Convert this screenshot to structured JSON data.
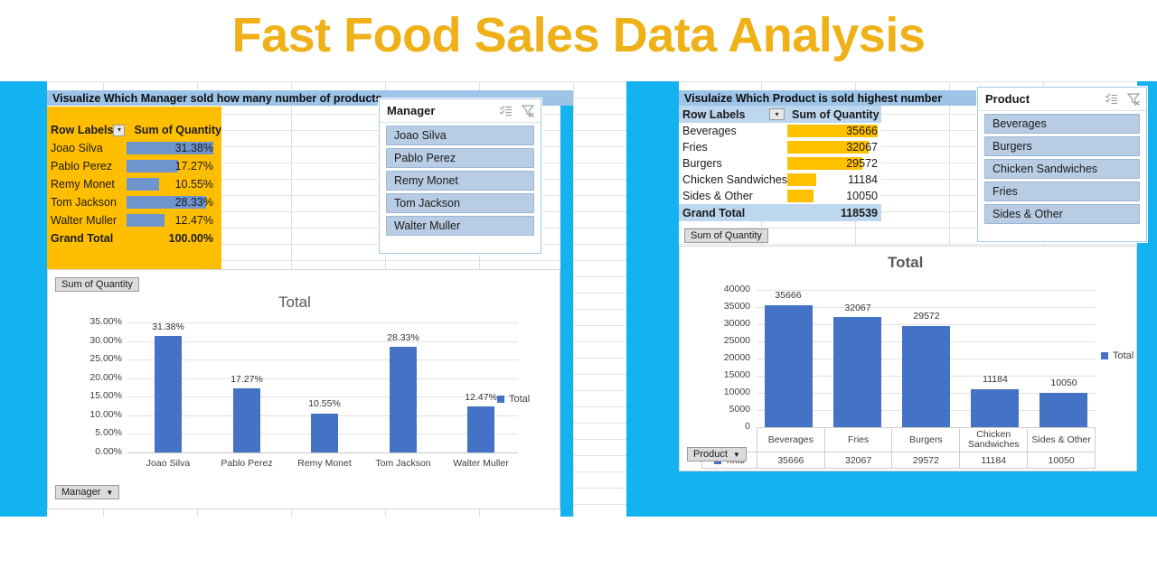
{
  "page": {
    "title": "Fast Food Sales Data Analysis",
    "title_color": "#EFB117",
    "background": "#13B2F0"
  },
  "left_panel": {
    "banner": "Visualize Which Manager sold how many number of products",
    "pivot": {
      "col_headers": [
        "Row Labels",
        "Sum of Quantity"
      ],
      "rows": [
        {
          "label": "Joao Silva",
          "value": "31.38%",
          "pct": 31.38
        },
        {
          "label": "Pablo Perez",
          "value": "17.27%",
          "pct": 17.27
        },
        {
          "label": "Remy Monet",
          "value": "10.55%",
          "pct": 10.55
        },
        {
          "label": "Tom Jackson",
          "value": "28.33%",
          "pct": 28.33
        },
        {
          "label": "Walter Muller",
          "value": "12.47%",
          "pct": 12.47
        }
      ],
      "total_label": "Grand Total",
      "total_value": "100.00%"
    },
    "slicer": {
      "title": "Manager",
      "multiselect_icon": "multi-select-icon",
      "clear_filter_icon": "clear-filter-icon",
      "items": [
        "Joao Silva",
        "Pablo Perez",
        "Remy Monet",
        "Tom Jackson",
        "Walter Muller"
      ]
    },
    "chart_field_button": "Sum of Quantity",
    "chart_axis_button": "Manager"
  },
  "right_panel": {
    "banner": "Visulaize Which Product is sold highest number",
    "pivot": {
      "col_headers": [
        "Row Labels",
        "Sum of Quantity"
      ],
      "rows": [
        {
          "label": "Beverages",
          "value": "35666",
          "num": 35666
        },
        {
          "label": "Fries",
          "value": "32067",
          "num": 32067
        },
        {
          "label": "Burgers",
          "value": "29572",
          "num": 29572
        },
        {
          "label": "Chicken Sandwiches",
          "value": "11184",
          "num": 11184
        },
        {
          "label": "Sides & Other",
          "value": "10050",
          "num": 10050
        }
      ],
      "total_label": "Grand Total",
      "total_value": "118539"
    },
    "slicer": {
      "title": "Product",
      "multiselect_icon": "multi-select-icon",
      "clear_filter_icon": "clear-filter-icon",
      "items": [
        "Beverages",
        "Burgers",
        "Chicken Sandwiches",
        "Fries",
        "Sides & Other"
      ]
    },
    "chart_field_button": "Sum of Quantity",
    "chart_axis_button": "Product"
  },
  "chart_data": [
    {
      "id": "manager_chart",
      "type": "bar",
      "title": "Total",
      "categories": [
        "Joao Silva",
        "Pablo Perez",
        "Remy Monet",
        "Tom Jackson",
        "Walter Muller"
      ],
      "values": [
        31.38,
        17.27,
        10.55,
        28.33,
        12.47
      ],
      "data_labels": [
        "31.38%",
        "17.27%",
        "10.55%",
        "28.33%",
        "12.47%"
      ],
      "series": [
        {
          "name": "Total",
          "values": [
            31.38,
            17.27,
            10.55,
            28.33,
            12.47
          ],
          "color": "#4472C4"
        }
      ],
      "ylim": [
        0,
        35
      ],
      "ytick_values": [
        0,
        5,
        10,
        15,
        20,
        25,
        30,
        35
      ],
      "ytick_labels": [
        "0.00%",
        "5.00%",
        "10.00%",
        "15.00%",
        "20.00%",
        "25.00%",
        "30.00%",
        "35.00%"
      ],
      "xlabel": "",
      "ylabel": "",
      "grid": true,
      "legend": [
        "Total"
      ],
      "legend_position": "right"
    },
    {
      "id": "product_chart",
      "type": "bar",
      "title": "Total",
      "categories": [
        "Beverages",
        "Fries",
        "Burgers",
        "Chicken Sandwiches",
        "Sides & Other"
      ],
      "values": [
        35666,
        32067,
        29572,
        11184,
        10050
      ],
      "data_labels": [
        "35666",
        "32067",
        "29572",
        "11184",
        "10050"
      ],
      "series": [
        {
          "name": "Total",
          "values": [
            35666,
            32067,
            29572,
            11184,
            10050
          ],
          "color": "#4472C4"
        }
      ],
      "ylim": [
        0,
        40000
      ],
      "ytick_values": [
        0,
        5000,
        10000,
        15000,
        20000,
        25000,
        30000,
        35000,
        40000
      ],
      "ytick_labels": [
        "0",
        "5000",
        "10000",
        "15000",
        "20000",
        "25000",
        "30000",
        "35000",
        "40000"
      ],
      "xlabel": "",
      "ylabel": "",
      "grid": true,
      "legend": [
        "Total"
      ],
      "legend_position": "right",
      "data_table": {
        "row_label": "Total",
        "values": [
          "35666",
          "32067",
          "29572",
          "11184",
          "10050"
        ]
      }
    }
  ]
}
